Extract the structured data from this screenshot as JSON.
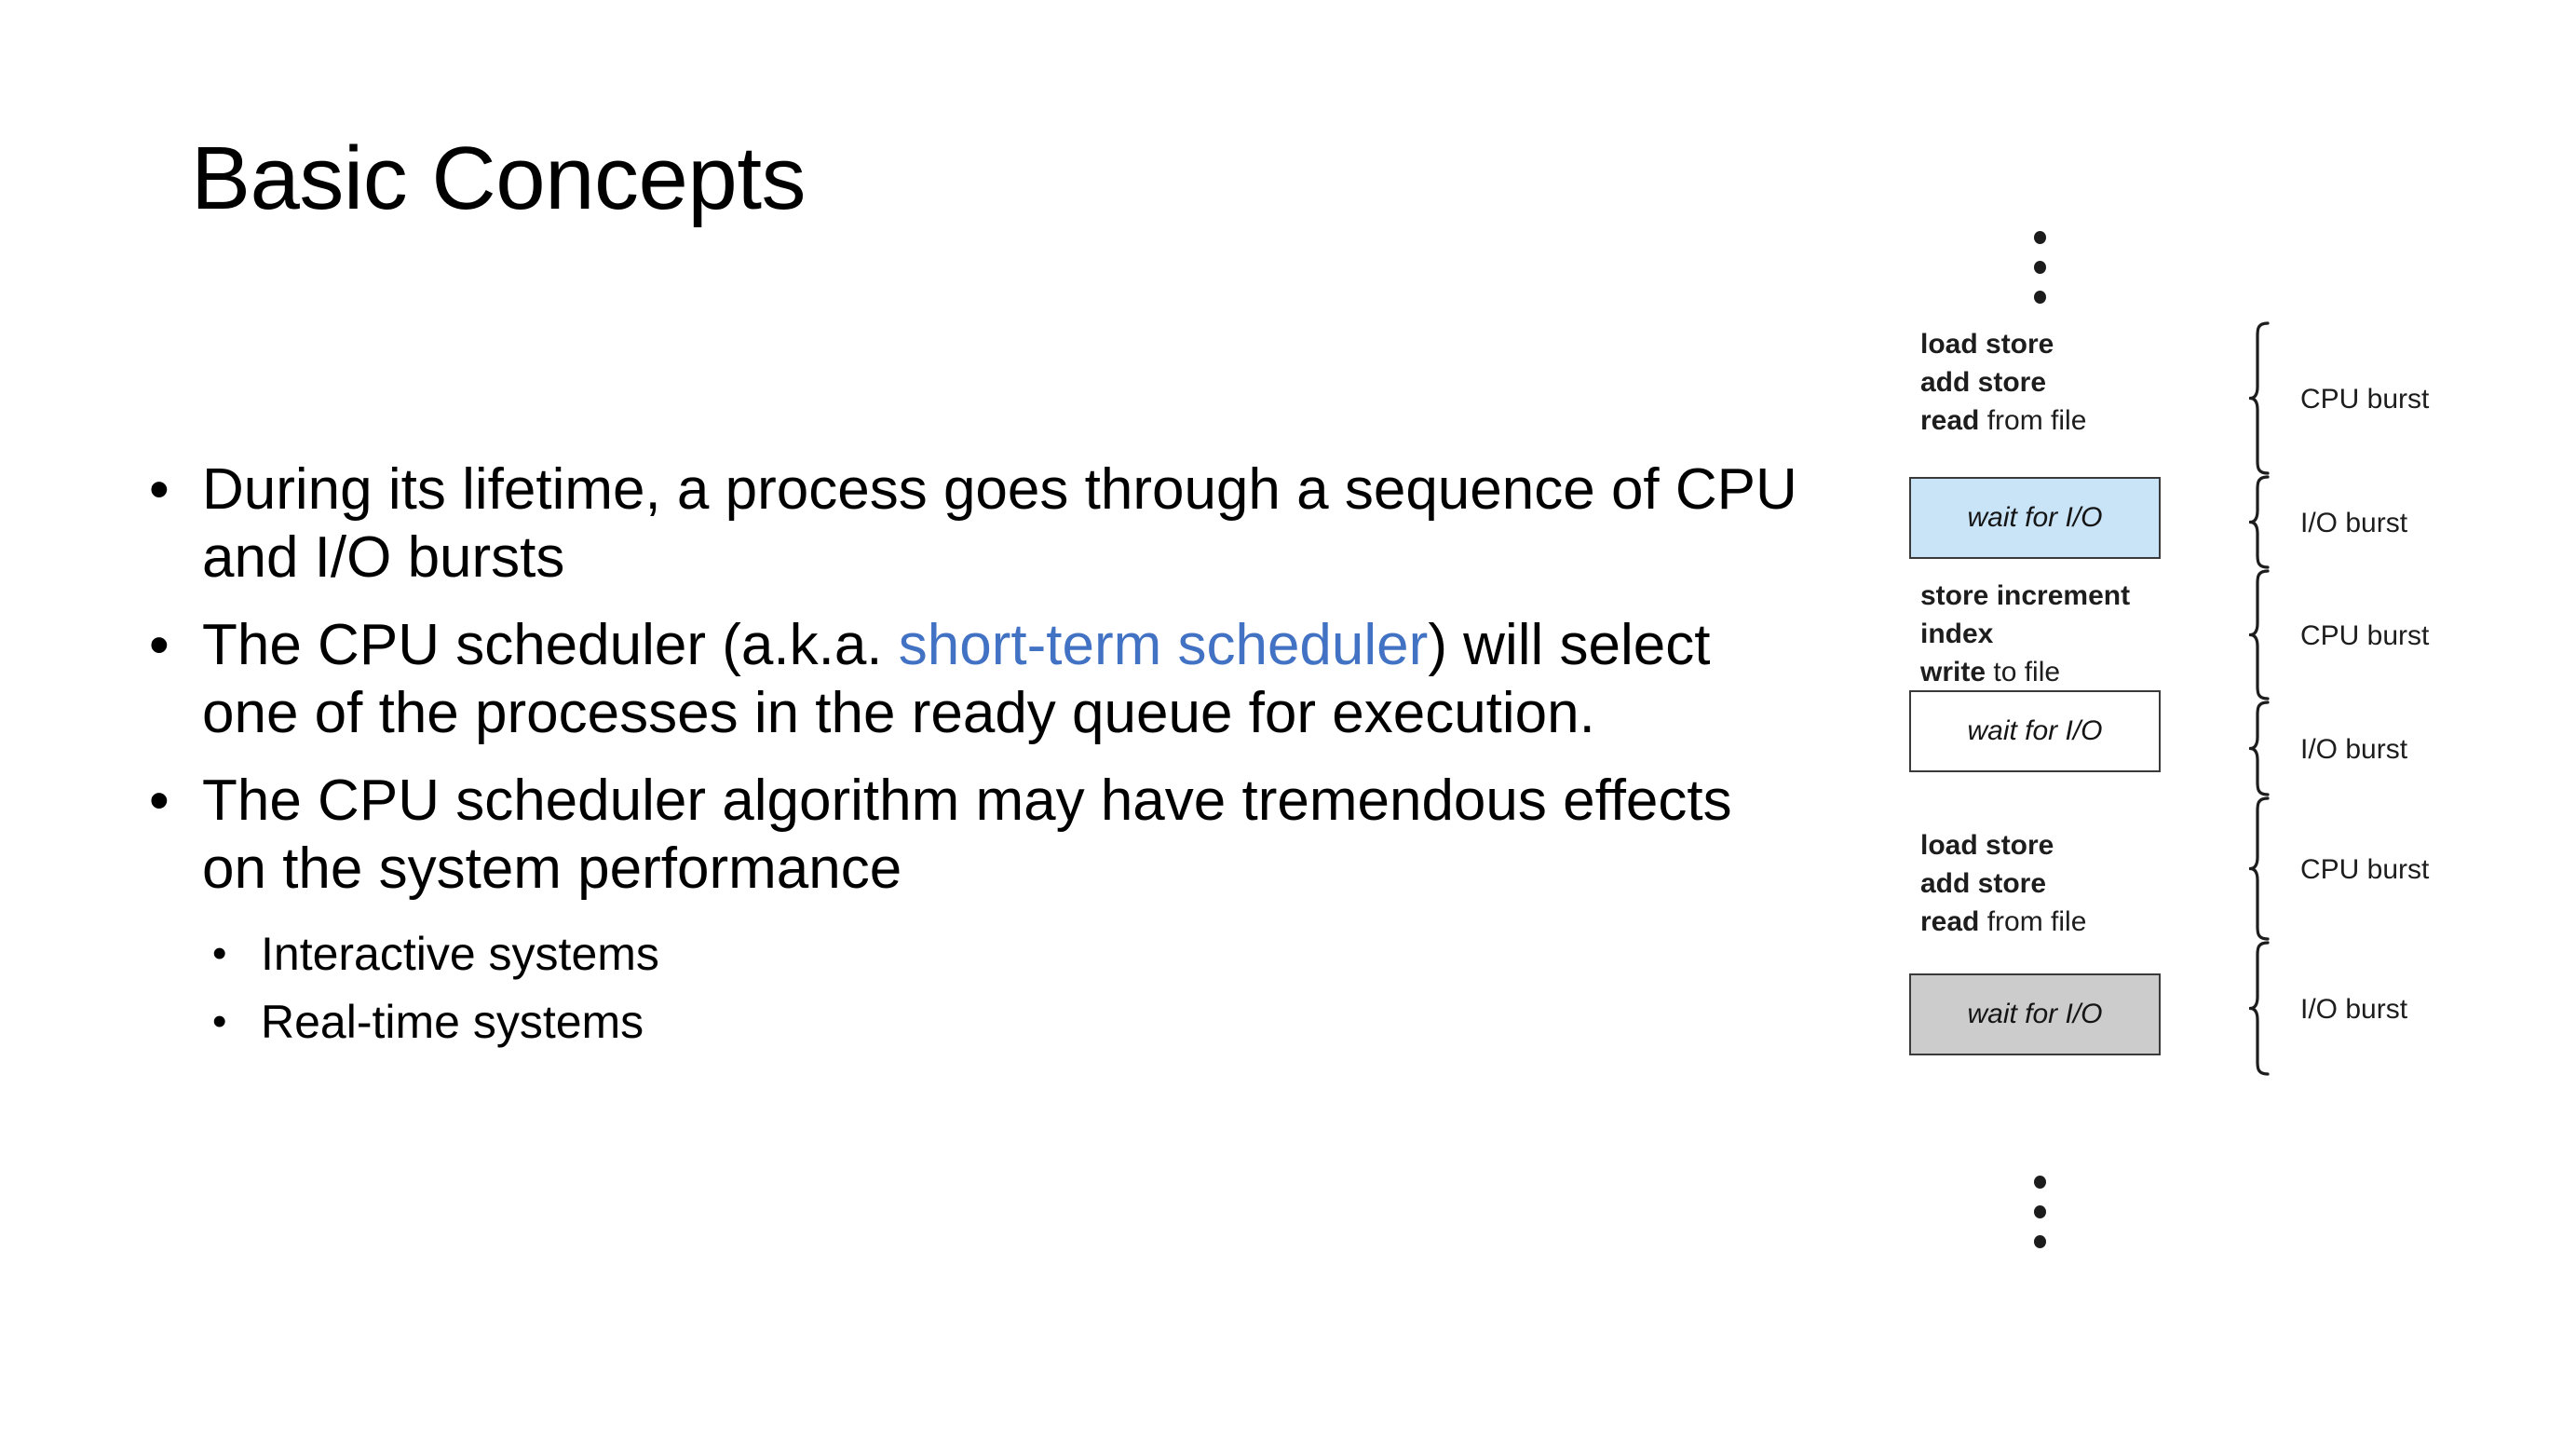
{
  "slide": {
    "title": "Basic Concepts",
    "accent_color": "#4272C3",
    "background": "#FFFFFF"
  },
  "body": {
    "bullets": [
      {
        "level": 1,
        "marker": "•",
        "segments": [
          {
            "text": "During its lifetime, a process goes through a sequence of CPU and I/O bursts",
            "style": "normal"
          }
        ]
      },
      {
        "level": 1,
        "marker": "•",
        "segments": [
          {
            "text": "The CPU scheduler (a.k.a. ",
            "style": "normal"
          },
          {
            "text": "short-term scheduler",
            "style": "accent"
          },
          {
            "text": ") will select one of the processes in the ready queue for execution.",
            "style": "normal"
          }
        ]
      },
      {
        "level": 1,
        "marker": "•",
        "segments": [
          {
            "text": "The CPU scheduler algorithm may have tremendous effects on the system performance",
            "style": "normal"
          }
        ]
      },
      {
        "level": 2,
        "marker": "•",
        "segments": [
          {
            "text": "Interactive systems",
            "style": "normal"
          }
        ]
      },
      {
        "level": 2,
        "marker": "•",
        "segments": [
          {
            "text": "Real-time systems",
            "style": "normal"
          }
        ]
      }
    ]
  },
  "diagram": {
    "name": "cpu-io-burst-cycle",
    "ellipsis_top": "⋮",
    "ellipsis_bottom": "⋮",
    "blocks": [
      {
        "kind": "instructions",
        "lines": [
          {
            "bold": "load store",
            "regular": ""
          },
          {
            "bold": "add store",
            "regular": ""
          },
          {
            "bold": "read",
            "regular": " from file"
          }
        ],
        "burst_label": "CPU burst"
      },
      {
        "kind": "wait-box",
        "label": "wait for I/O",
        "fill": "#C9E3F7",
        "fill_name": "blue",
        "burst_label": "I/O burst"
      },
      {
        "kind": "instructions",
        "lines": [
          {
            "bold": "store increment",
            "regular": ""
          },
          {
            "bold": "index",
            "regular": ""
          },
          {
            "bold": "write",
            "regular": " to file"
          }
        ],
        "burst_label": "CPU burst"
      },
      {
        "kind": "wait-box",
        "label": "wait for I/O",
        "fill": "#FFFFFF",
        "fill_name": "white",
        "burst_label": "I/O burst"
      },
      {
        "kind": "instructions",
        "lines": [
          {
            "bold": "load store",
            "regular": ""
          },
          {
            "bold": "add store",
            "regular": ""
          },
          {
            "bold": "read",
            "regular": " from file"
          }
        ],
        "burst_label": "CPU burst"
      },
      {
        "kind": "wait-box",
        "label": "wait for I/O",
        "fill": "#CCCCCC",
        "fill_name": "gray",
        "burst_label": "I/O burst"
      }
    ],
    "burst_labels": [
      "CPU burst",
      "I/O burst",
      "CPU burst",
      "I/O burst",
      "CPU burst",
      "I/O burst"
    ]
  }
}
